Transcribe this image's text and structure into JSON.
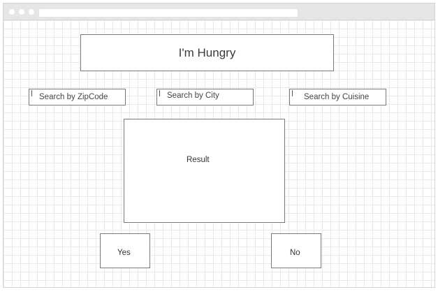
{
  "app": {
    "title": "I'm Hungry"
  },
  "search": {
    "zipcode_placeholder": "Search by ZipCode",
    "city_placeholder": "Search by City",
    "cuisine_placeholder": "Search by Cuisine"
  },
  "result": {
    "label": "Result"
  },
  "actions": {
    "yes_label": "Yes",
    "no_label": "No"
  },
  "colors": {
    "border": "#7a7a7a",
    "grid": "#e9e9e9",
    "chrome": "#e6e6e6"
  }
}
